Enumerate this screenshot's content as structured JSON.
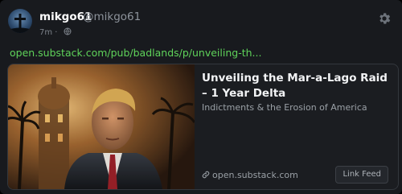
{
  "post": {
    "display_name": "mikgo61",
    "handle": "@mikgo61",
    "time": "7m",
    "separator": "·",
    "link_text": "open.substack.com/pub/badlands/p/unveiling-th..."
  },
  "card": {
    "title": "Unveiling the Mar-a-Lago Raid – 1 Year Delta",
    "description": "Indictments & the Erosion of America",
    "domain": "open.substack.com",
    "link_feed_label": "Link Feed"
  },
  "icons": {
    "visibility": "globe-icon",
    "settings": "gear-icon",
    "domain": "link-icon"
  },
  "colors": {
    "link": "#5fd35a",
    "background": "#181a1e"
  }
}
